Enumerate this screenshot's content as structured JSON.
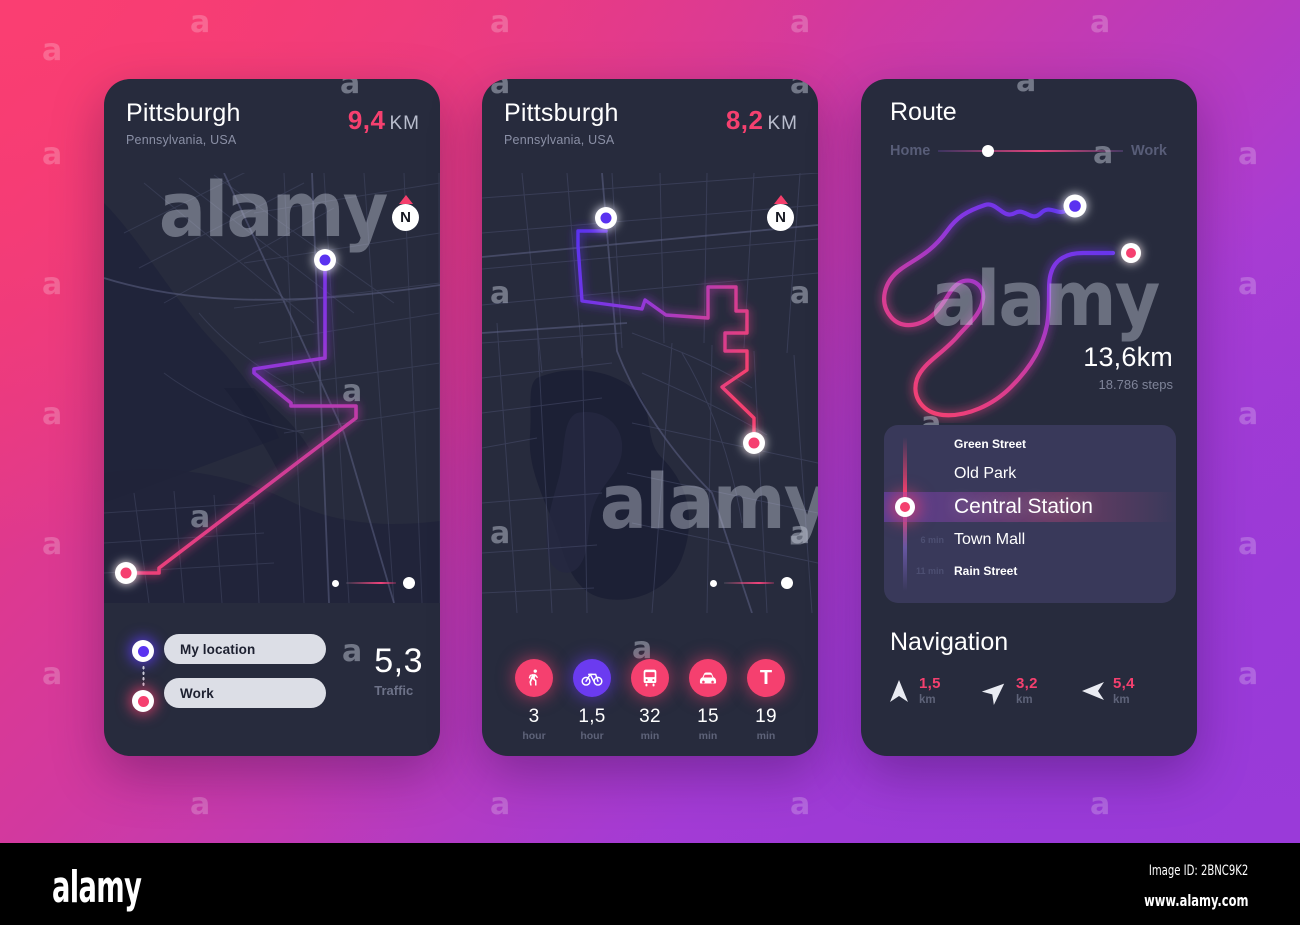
{
  "theme": {
    "bg_pink": "#f5396f",
    "bg_purple": "#9039d6",
    "panel": "#272b3d",
    "accent_pink": "#f5406f",
    "accent_violet": "#5a33f0",
    "card": "#39395a"
  },
  "phone1": {
    "city": "Pittsburgh",
    "region": "Pennsylvania, USA",
    "distance_value": "9,4",
    "distance_unit": "KM",
    "compass_label": "N",
    "origin_label": "My location",
    "destination_label": "Work",
    "traffic_value": "5,3",
    "traffic_label": "Traffic"
  },
  "phone2": {
    "city": "Pittsburgh",
    "region": "Pennsylvania, USA",
    "distance_value": "8,2",
    "distance_unit": "KM",
    "compass_label": "N",
    "modes": [
      {
        "icon": "walking-icon",
        "value": "3",
        "unit": "hour",
        "color": "pink"
      },
      {
        "icon": "bicycle-icon",
        "value": "1,5",
        "unit": "hour",
        "color": "violet"
      },
      {
        "icon": "bus-icon",
        "value": "32",
        "unit": "min",
        "color": "pink"
      },
      {
        "icon": "car-icon",
        "value": "15",
        "unit": "min",
        "color": "pink"
      },
      {
        "icon": "taxi-t-icon",
        "value": "19",
        "unit": "min",
        "color": "pink",
        "glyph": "T"
      }
    ]
  },
  "phone3": {
    "title": "Route",
    "slider_start": "Home",
    "slider_end": "Work",
    "total_distance": "13,6km",
    "total_steps": "18.786 steps",
    "stations": [
      {
        "name": "Green Street",
        "time": ""
      },
      {
        "name": "Old Park",
        "time": ""
      },
      {
        "name": "Central Station",
        "time": ""
      },
      {
        "name": "Town Mall",
        "time": "6 min"
      },
      {
        "name": "Rain Street",
        "time": "11 min"
      }
    ],
    "nav_title": "Navigation",
    "nav_steps": [
      {
        "icon": "arrow-straight-icon",
        "distance": "1,5",
        "unit": "km"
      },
      {
        "icon": "arrow-right-turn-icon",
        "distance": "3,2",
        "unit": "km"
      },
      {
        "icon": "arrow-left-turn-icon",
        "distance": "5,4",
        "unit": "km"
      }
    ]
  },
  "footer": {
    "logo": "alamy",
    "image_id": "Image ID: 2BNC9K2",
    "url": "www.alamy.com"
  },
  "watermark": {
    "letter": "a",
    "word": "alamy"
  }
}
